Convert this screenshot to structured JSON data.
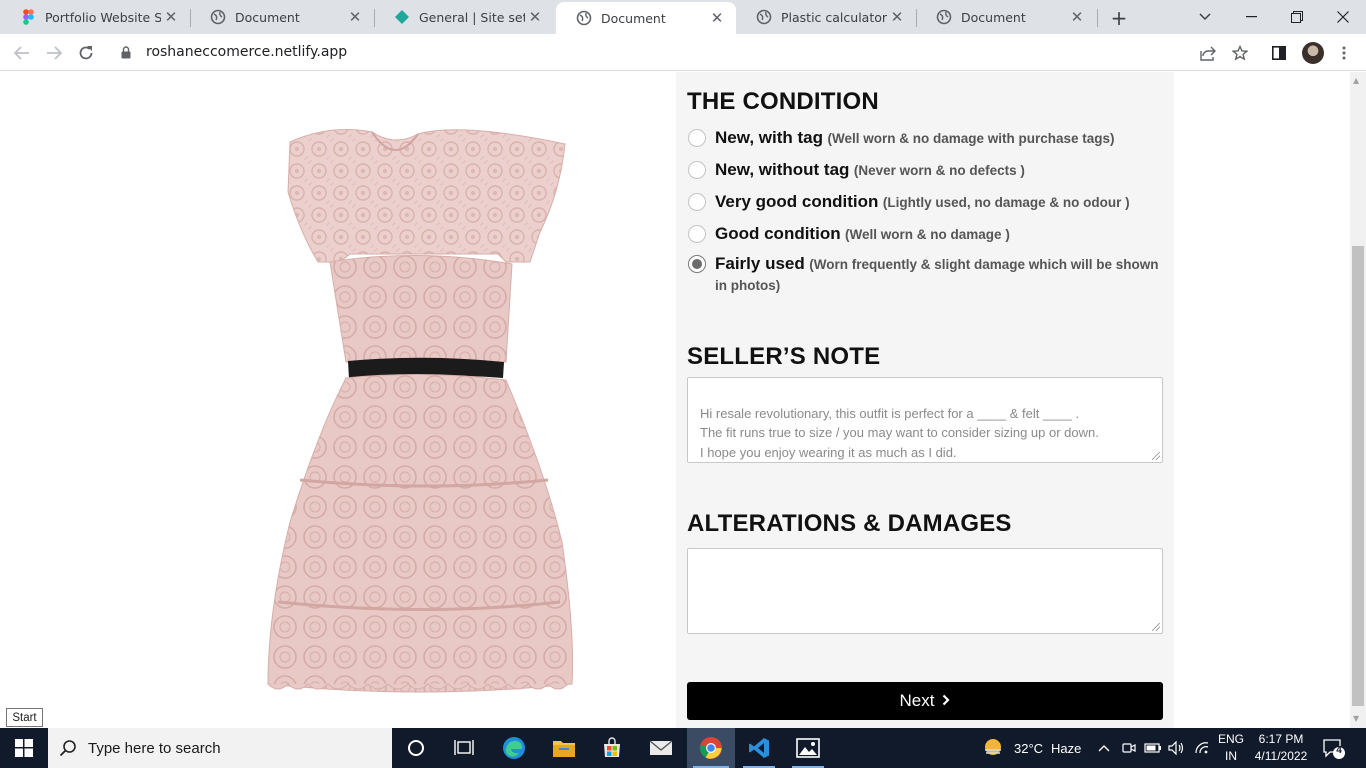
{
  "browser": {
    "tabs": [
      {
        "title": "Portfolio Website Sam",
        "icon": "figma-icon",
        "active": false
      },
      {
        "title": "Document",
        "icon": "globe-icon",
        "active": false
      },
      {
        "title": "General | Site settings",
        "icon": "netlify-icon",
        "active": false
      },
      {
        "title": "Document",
        "icon": "globe-icon",
        "active": true
      },
      {
        "title": "Plastic calculator",
        "icon": "globe-icon",
        "active": false
      },
      {
        "title": "Document",
        "icon": "globe-icon",
        "active": false
      }
    ],
    "url": "roshaneccomerce.netlify.app"
  },
  "product": {
    "image": "pink-lace-dress",
    "colors": {
      "lace": "#e7c6c4",
      "belt": "#1b1b1b"
    }
  },
  "condition": {
    "title": "THE CONDITION",
    "options": [
      {
        "label": "New, with tag",
        "detail": "(Well worn & no damage with purchase tags)",
        "checked": false
      },
      {
        "label": "New, without tag",
        "detail": "(Never worn & no defects )",
        "checked": false
      },
      {
        "label": "Very good condition",
        "detail": "(Lightly used, no damage & no odour )",
        "checked": false
      },
      {
        "label": "Good condition",
        "detail": "(Well worn & no damage )",
        "checked": false
      },
      {
        "label": "Fairly used",
        "detail": "(Worn frequently & slight damage which will be shown in photos)",
        "checked": true
      }
    ]
  },
  "seller_note": {
    "title": "SELLER’S NOTE",
    "placeholder": "Hi resale revolutionary, this outfit is perfect for a ____ & felt ____ .\nThe fit runs true to size / you may want to consider sizing up or down.\nI hope you enjoy wearing it as much as I did."
  },
  "alterations": {
    "title": "ALTERATIONS & DAMAGES",
    "value": ""
  },
  "next_button": {
    "label": "Next"
  },
  "tooltip": {
    "text": "Start"
  },
  "taskbar": {
    "search_placeholder": "Type here to search",
    "weather": {
      "temp": "32°C",
      "condition": "Haze"
    },
    "language": {
      "line1": "ENG",
      "line2": "IN"
    },
    "time": "6:17 PM",
    "date": "4/11/2022",
    "notifications": "4"
  }
}
